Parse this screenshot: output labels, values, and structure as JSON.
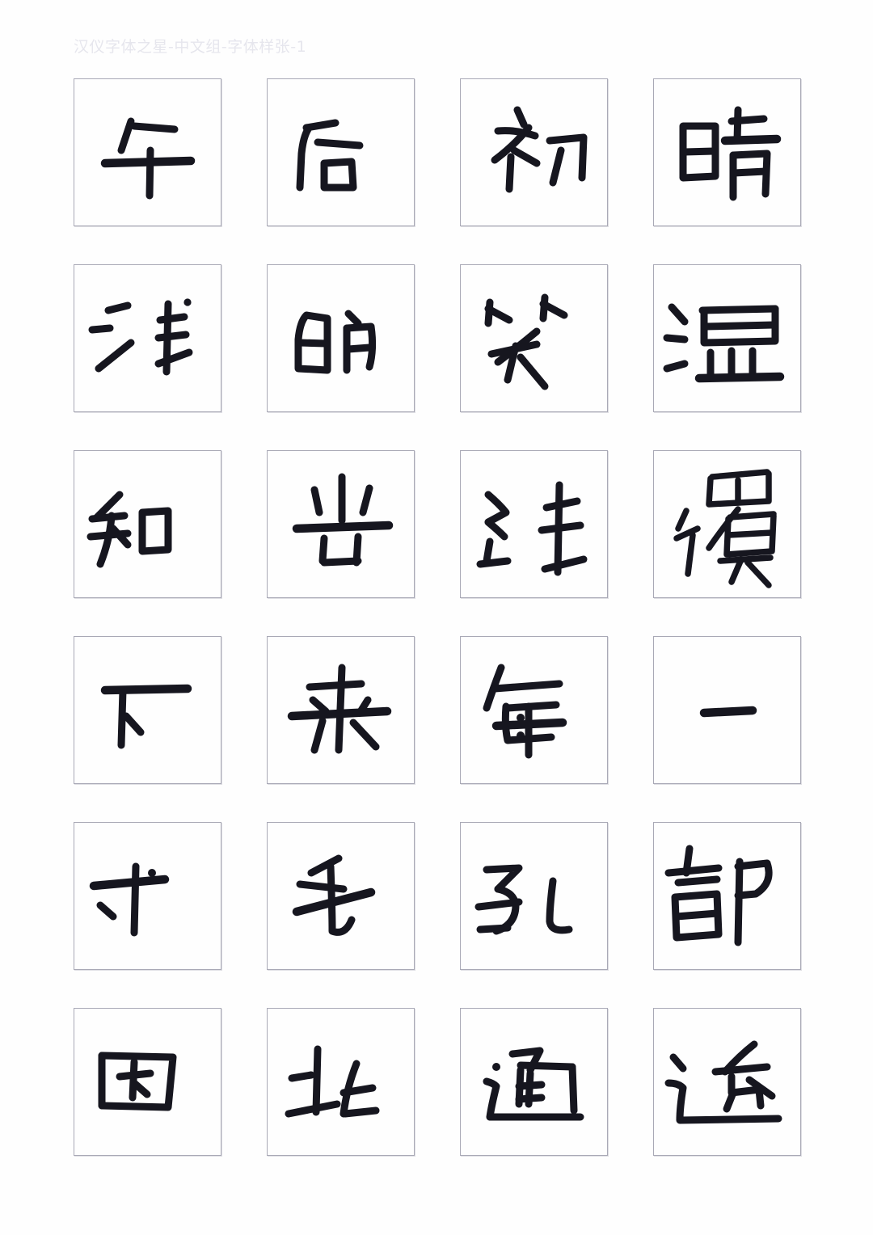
{
  "header": {
    "title": "汉仪字体之星-中文组-字体样张-1",
    "title_color": "#e6e6ed"
  },
  "theme": {
    "page_background": "#fefefe",
    "cell_border": "#a9a9b6",
    "ink": "#16161f"
  },
  "specimen": {
    "columns": 4,
    "rows": 6,
    "cell_size_px": 183,
    "sentence": "午后初晴浅的笑温和光线復下来每一寸毛孔都因此通透",
    "glyphs": [
      {
        "char": "午",
        "row": 1,
        "col": 1
      },
      {
        "char": "后",
        "row": 1,
        "col": 2
      },
      {
        "char": "初",
        "row": 1,
        "col": 3
      },
      {
        "char": "晴",
        "row": 1,
        "col": 4
      },
      {
        "char": "浅",
        "row": 2,
        "col": 1
      },
      {
        "char": "的",
        "row": 2,
        "col": 2
      },
      {
        "char": "笑",
        "row": 2,
        "col": 3
      },
      {
        "char": "温",
        "row": 2,
        "col": 4
      },
      {
        "char": "和",
        "row": 3,
        "col": 1
      },
      {
        "char": "光",
        "row": 3,
        "col": 2
      },
      {
        "char": "线",
        "row": 3,
        "col": 3
      },
      {
        "char": "復",
        "row": 3,
        "col": 4
      },
      {
        "char": "下",
        "row": 4,
        "col": 1
      },
      {
        "char": "来",
        "row": 4,
        "col": 2
      },
      {
        "char": "每",
        "row": 4,
        "col": 3
      },
      {
        "char": "一",
        "row": 4,
        "col": 4
      },
      {
        "char": "寸",
        "row": 5,
        "col": 1
      },
      {
        "char": "毛",
        "row": 5,
        "col": 2
      },
      {
        "char": "孔",
        "row": 5,
        "col": 3
      },
      {
        "char": "都",
        "row": 5,
        "col": 4
      },
      {
        "char": "因",
        "row": 6,
        "col": 1
      },
      {
        "char": "此",
        "row": 6,
        "col": 2
      },
      {
        "char": "通",
        "row": 6,
        "col": 3
      },
      {
        "char": "透",
        "row": 6,
        "col": 4
      }
    ]
  }
}
